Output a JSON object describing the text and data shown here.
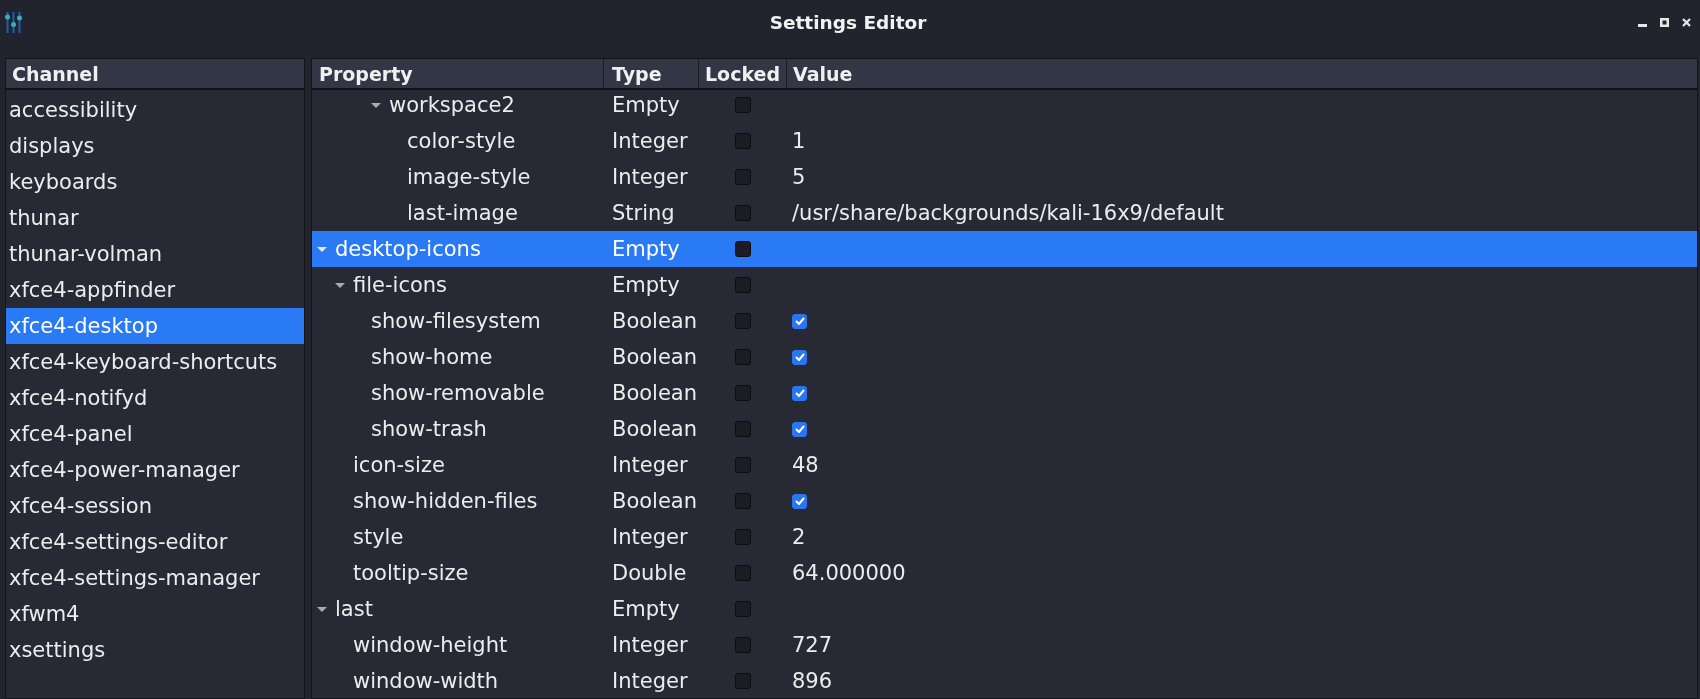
{
  "window": {
    "title": "Settings Editor"
  },
  "channels": {
    "header": "Channel",
    "items": [
      {
        "name": "accessibility",
        "selected": false
      },
      {
        "name": "displays",
        "selected": false
      },
      {
        "name": "keyboards",
        "selected": false
      },
      {
        "name": "thunar",
        "selected": false
      },
      {
        "name": "thunar-volman",
        "selected": false
      },
      {
        "name": "xfce4-appfinder",
        "selected": false
      },
      {
        "name": "xfce4-desktop",
        "selected": true
      },
      {
        "name": "xfce4-keyboard-shortcuts",
        "selected": false
      },
      {
        "name": "xfce4-notifyd",
        "selected": false
      },
      {
        "name": "xfce4-panel",
        "selected": false
      },
      {
        "name": "xfce4-power-manager",
        "selected": false
      },
      {
        "name": "xfce4-session",
        "selected": false
      },
      {
        "name": "xfce4-settings-editor",
        "selected": false
      },
      {
        "name": "xfce4-settings-manager",
        "selected": false
      },
      {
        "name": "xfwm4",
        "selected": false
      },
      {
        "name": "xsettings",
        "selected": false
      }
    ]
  },
  "properties": {
    "columns": [
      "Property",
      "Type",
      "Locked",
      "Value"
    ],
    "rows": [
      {
        "children": [
          {
            "children": [
              {
                "children": [
                  {
                    "name": "workspace2",
                    "type": "Empty",
                    "kind": "branch",
                    "locked": false,
                    "selected": false,
                    "expanded": true,
                    "children": [
                      {
                        "name": "color-style",
                        "type": "Integer",
                        "kind": "text",
                        "locked": false,
                        "selected": false,
                        "value": "1"
                      },
                      {
                        "name": "image-style",
                        "type": "Integer",
                        "kind": "text",
                        "locked": false,
                        "selected": false,
                        "value": "5"
                      },
                      {
                        "name": "last-image",
                        "type": "String",
                        "kind": "text",
                        "locked": false,
                        "selected": false,
                        "value": "/usr/share/backgrounds/kali-16x9/default"
                      }
                    ]
                  }
                ]
              }
            ]
          }
        ]
      },
      {
        "name": "desktop-icons",
        "type": "Empty",
        "kind": "branch",
        "locked": false,
        "selected": true,
        "expanded": true,
        "children": [
          {
            "name": "file-icons",
            "type": "Empty",
            "kind": "branch",
            "locked": false,
            "selected": false,
            "expanded": true,
            "children": [
              {
                "name": "show-filesystem",
                "type": "Boolean",
                "kind": "bool",
                "locked": false,
                "selected": false,
                "checked": true
              },
              {
                "name": "show-home",
                "type": "Boolean",
                "kind": "bool",
                "locked": false,
                "selected": false,
                "checked": true
              },
              {
                "name": "show-removable",
                "type": "Boolean",
                "kind": "bool",
                "locked": false,
                "selected": false,
                "checked": true
              },
              {
                "name": "show-trash",
                "type": "Boolean",
                "kind": "bool",
                "locked": false,
                "selected": false,
                "checked": true
              }
            ]
          },
          {
            "name": "icon-size",
            "type": "Integer",
            "kind": "text",
            "locked": false,
            "selected": false,
            "value": "48"
          },
          {
            "name": "show-hidden-files",
            "type": "Boolean",
            "kind": "bool",
            "locked": false,
            "selected": false,
            "checked": true
          },
          {
            "name": "style",
            "type": "Integer",
            "kind": "text",
            "locked": false,
            "selected": false,
            "value": "2"
          },
          {
            "name": "tooltip-size",
            "type": "Double",
            "kind": "text",
            "locked": false,
            "selected": false,
            "value": "64.000000"
          }
        ]
      },
      {
        "name": "last",
        "type": "Empty",
        "kind": "branch",
        "locked": false,
        "selected": false,
        "expanded": true,
        "children": [
          {
            "name": "window-height",
            "type": "Integer",
            "kind": "text",
            "locked": false,
            "selected": false,
            "value": "727"
          },
          {
            "name": "window-width",
            "type": "Integer",
            "kind": "text",
            "locked": false,
            "selected": false,
            "value": "896"
          }
        ]
      }
    ]
  }
}
